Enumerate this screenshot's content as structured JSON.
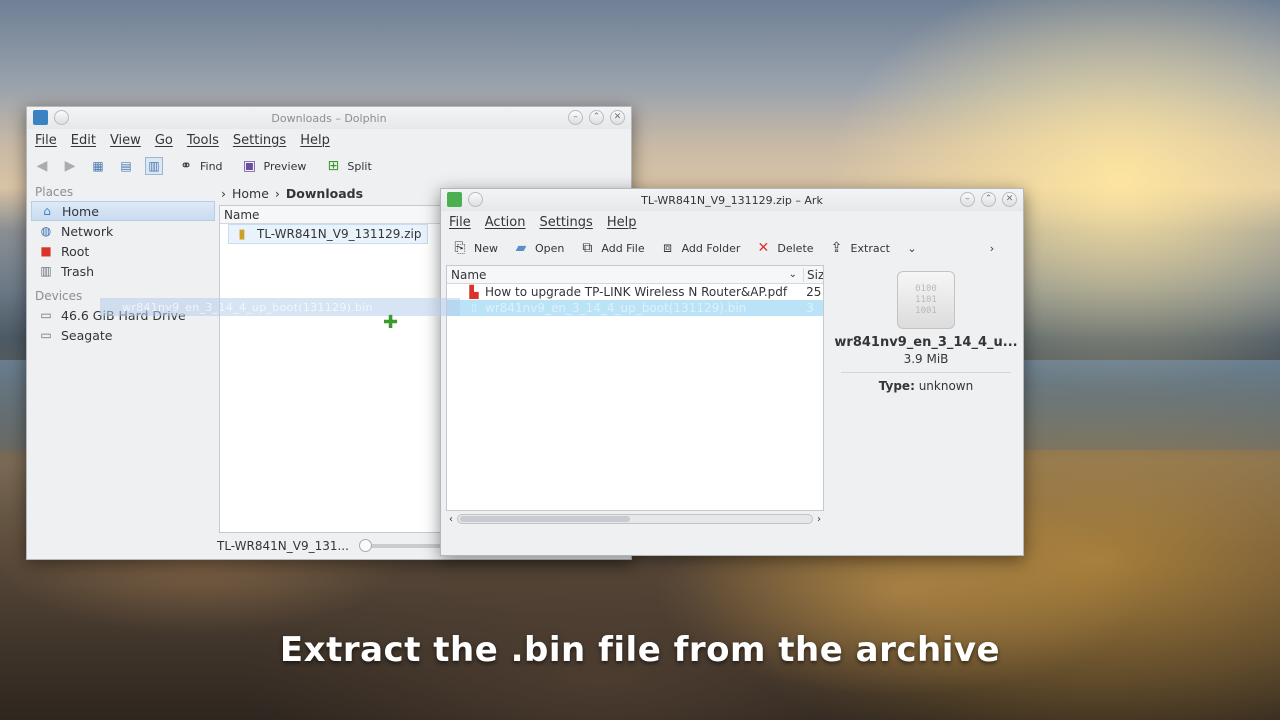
{
  "caption": "Extract the .bin file from the archive",
  "dolphin": {
    "title": "Downloads – Dolphin",
    "menu": [
      "File",
      "Edit",
      "View",
      "Go",
      "Tools",
      "Settings",
      "Help"
    ],
    "toolbar": {
      "find": "Find",
      "preview": "Preview",
      "split": "Split"
    },
    "places_header": "Places",
    "places": [
      "Home",
      "Network",
      "Root",
      "Trash"
    ],
    "devices_header": "Devices",
    "devices": [
      "46.6 GiB Hard Drive",
      "Seagate"
    ],
    "breadcrumb": {
      "home": "Home",
      "current": "Downloads"
    },
    "column_name": "Name",
    "file": "TL-WR841N_V9_131129.zip",
    "status": "TL-WR841N_V9_131...",
    "drag_ghost": "wr841nv9_en_3_14_4_up_boot(131129).bin"
  },
  "ark": {
    "title": "TL-WR841N_V9_131129.zip – Ark",
    "menu": [
      "File",
      "Action",
      "Settings",
      "Help"
    ],
    "toolbar": {
      "new": "New",
      "open": "Open",
      "add_file": "Add File",
      "add_folder": "Add Folder",
      "delete": "Delete",
      "extract": "Extract"
    },
    "column_name": "Name",
    "column_size": "Siz",
    "rows": [
      {
        "name": "How to upgrade TP-LINK Wireless N Router&AP.pdf",
        "size": "25"
      },
      {
        "name": "wr841nv9_en_3_14_4_up_boot(131129).bin",
        "size": "3"
      }
    ],
    "info": {
      "name": "wr841nv9_en_3_14_4_u...",
      "size": "3.9 MiB",
      "type_label": "Type:",
      "type_value": "unknown",
      "icon_lines": [
        "0100",
        "1101",
        "1001"
      ]
    }
  }
}
